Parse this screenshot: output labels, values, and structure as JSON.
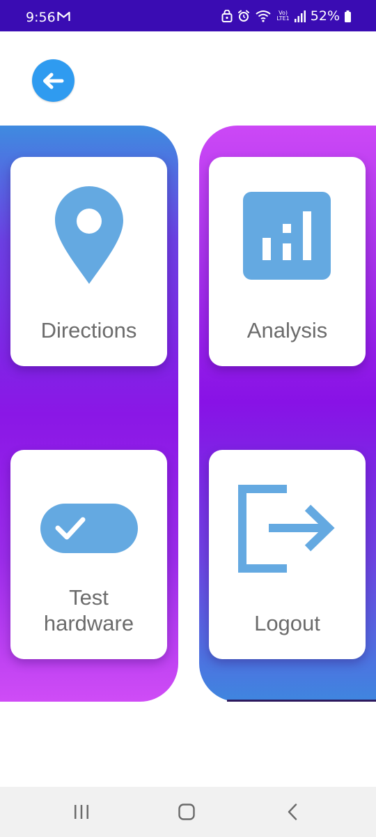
{
  "status_bar": {
    "time": "9:56",
    "volte_line1": "Vo)",
    "volte_line2": "LTE1",
    "battery": "52%"
  },
  "back_button": {
    "icon": "arrow-left-icon"
  },
  "cards": [
    {
      "label": "Directions",
      "icon": "location-pin-icon"
    },
    {
      "label": "Analysis",
      "icon": "bar-chart-icon"
    },
    {
      "label_line1": "Test",
      "label_line2": "hardware",
      "icon": "toggle-check-icon"
    },
    {
      "label": "Logout",
      "icon": "logout-icon"
    }
  ],
  "colors": {
    "status_bar": "#3a0cb3",
    "accent_blue": "#2f9bf0",
    "icon_blue": "#64a9e1",
    "gradient_purple": "#8a17e6",
    "gradient_pink": "#cf4cf6",
    "gradient_blue": "#3f8be0"
  },
  "nav": {
    "recents_icon": "recents-icon",
    "home_icon": "home-icon",
    "back_icon": "back-chevron-icon"
  }
}
